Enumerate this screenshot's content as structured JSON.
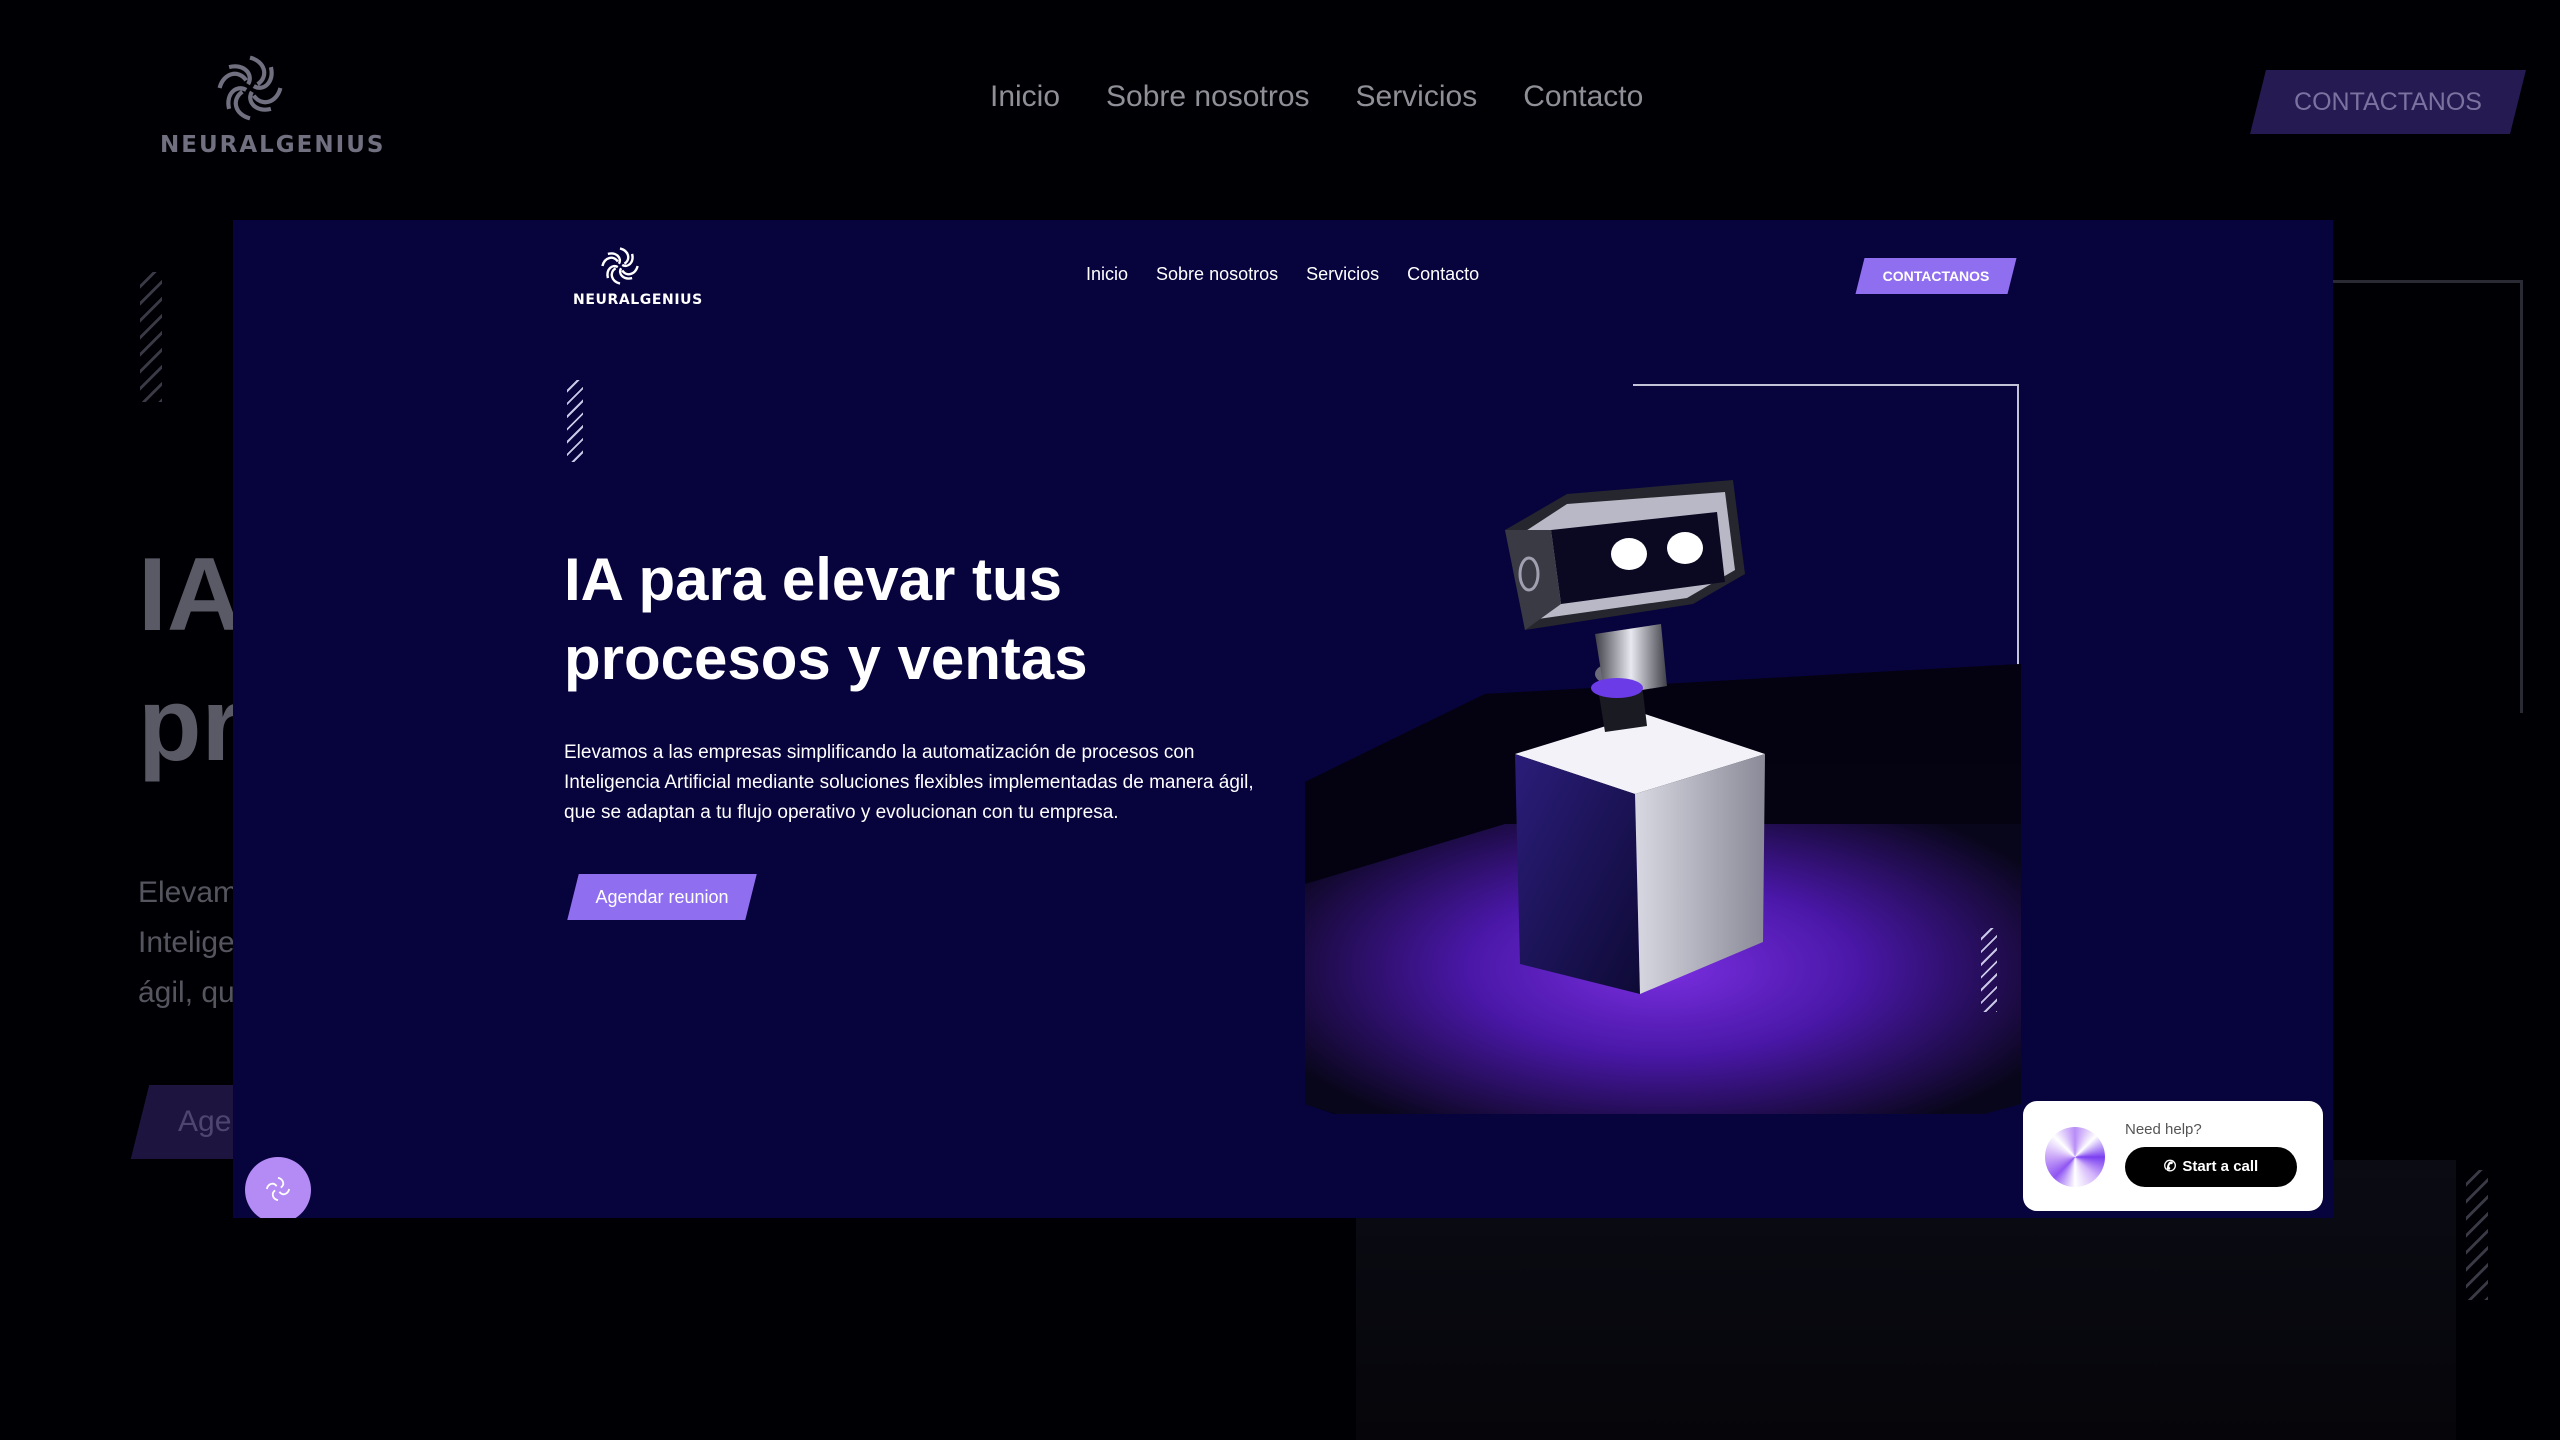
{
  "brand": {
    "name": "NEURALGENIUS"
  },
  "nav": {
    "items": [
      {
        "label": "Inicio"
      },
      {
        "label": "Sobre nosotros"
      },
      {
        "label": "Servicios"
      },
      {
        "label": "Contacto"
      }
    ],
    "cta_label": "CONTACTANOS"
  },
  "hero": {
    "title": "IA para elevar tus procesos y ventas",
    "description": "Elevamos a las empresas simplificando la automatización de procesos con Inteligencia Artificial mediante soluciones flexibles implementadas de manera ágil, que se adaptan a tu flujo operativo y evolucionan con tu empresa.",
    "button_label": "Agendar reunion"
  },
  "background": {
    "title_fragment_1": "IA",
    "title_fragment_2": "pr",
    "desc_fragment_1": "Elevam",
    "desc_fragment_2": "Intelige",
    "desc_fragment_3": "ágil, qu",
    "button_fragment": "Age"
  },
  "help_widget": {
    "prompt": "Need help?",
    "call_label": "Start a call"
  },
  "colors": {
    "page_background": "#000004",
    "screen_background": "#07033d",
    "accent": "#8f6ff0",
    "fab": "#b48af5"
  },
  "icons": [
    "neural-logo-icon",
    "robot-illustration",
    "phone-icon"
  ]
}
